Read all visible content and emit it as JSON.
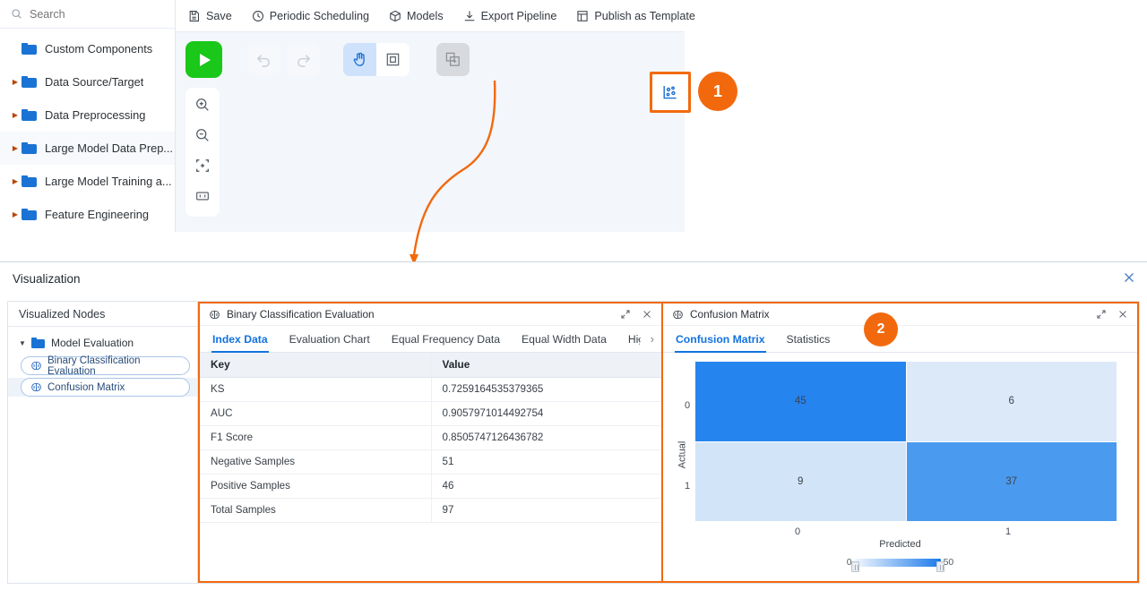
{
  "search": {
    "placeholder": "Search",
    "icon": "search-icon"
  },
  "sidebar": {
    "items": [
      {
        "label": "Custom Components",
        "expandable": false
      },
      {
        "label": "Data Source/Target",
        "expandable": true
      },
      {
        "label": "Data Preprocessing",
        "expandable": true
      },
      {
        "label": "Large Model Data Prep...",
        "expandable": true
      },
      {
        "label": "Large Model Training a...",
        "expandable": true
      },
      {
        "label": "Feature Engineering",
        "expandable": true
      }
    ]
  },
  "toolbar": {
    "items": [
      {
        "label": "Save",
        "icon": "save-icon"
      },
      {
        "label": "Periodic Scheduling",
        "icon": "clock-icon"
      },
      {
        "label": "Models",
        "icon": "cube-icon"
      },
      {
        "label": "Export Pipeline",
        "icon": "export-icon"
      },
      {
        "label": "Publish as Template",
        "icon": "template-icon"
      }
    ]
  },
  "canvas_tools": {
    "run": "run-button",
    "undo": "undo-icon",
    "redo": "redo-icon",
    "pan": "hand-icon",
    "select": "select-box-icon",
    "add_node": "add-node-icon",
    "visualization": "visualization-icon",
    "zoom_in": "zoom-in-icon",
    "zoom_out": "zoom-out-icon",
    "fit": "fit-screen-icon",
    "ratio": "one-to-one-icon"
  },
  "annotations": {
    "marker_one": "1",
    "marker_two": "2",
    "accent": "#f2690d"
  },
  "visualization": {
    "title": "Visualization",
    "close_icon": "close-icon",
    "nodes_panel": {
      "header": "Visualized Nodes",
      "group": "Model Evaluation",
      "nodes": [
        {
          "label": "Binary Classification Evaluation",
          "selected": false
        },
        {
          "label": "Confusion Matrix",
          "selected": true
        }
      ]
    },
    "panel_left": {
      "title": "Binary Classification Evaluation",
      "expand_icon": "expand-icon",
      "close_icon": "close-icon",
      "tabs": [
        {
          "label": "Index Data",
          "active": true
        },
        {
          "label": "Evaluation Chart",
          "active": false
        },
        {
          "label": "Equal Frequency Data",
          "active": false
        },
        {
          "label": "Equal Width Data",
          "active": false
        },
        {
          "label": "High-se",
          "active": false
        }
      ],
      "tab_prev": "‹",
      "tab_next": "›",
      "table": {
        "columns": [
          "Key",
          "Value"
        ],
        "rows": [
          [
            "KS",
            "0.7259164535379365"
          ],
          [
            "AUC",
            "0.9057971014492754"
          ],
          [
            "F1 Score",
            "0.8505747126436782"
          ],
          [
            "Negative Samples",
            "51"
          ],
          [
            "Positive Samples",
            "46"
          ],
          [
            "Total Samples",
            "97"
          ]
        ]
      }
    },
    "panel_right": {
      "title": "Confusion Matrix",
      "expand_icon": "expand-icon",
      "close_icon": "close-icon",
      "tabs": [
        {
          "label": "Confusion Matrix",
          "active": true
        },
        {
          "label": "Statistics",
          "active": false
        }
      ]
    }
  },
  "chart_data": {
    "type": "heatmap",
    "title": "Confusion Matrix",
    "xlabel": "Predicted",
    "ylabel": "Actual",
    "x_ticks": [
      "0",
      "1"
    ],
    "y_ticks": [
      "0",
      "1"
    ],
    "matrix": [
      [
        45,
        6
      ],
      [
        9,
        37
      ]
    ],
    "cell_colors": [
      [
        "#2584ee",
        "#dce9f9"
      ],
      [
        "#d2e4f8",
        "#4a9bef"
      ]
    ],
    "colorbar": {
      "min": "0",
      "max": "50",
      "low_color": "#f2f7fd",
      "high_color": "#1a7aea"
    },
    "grid": false,
    "legend": "colorbar-bottom"
  }
}
